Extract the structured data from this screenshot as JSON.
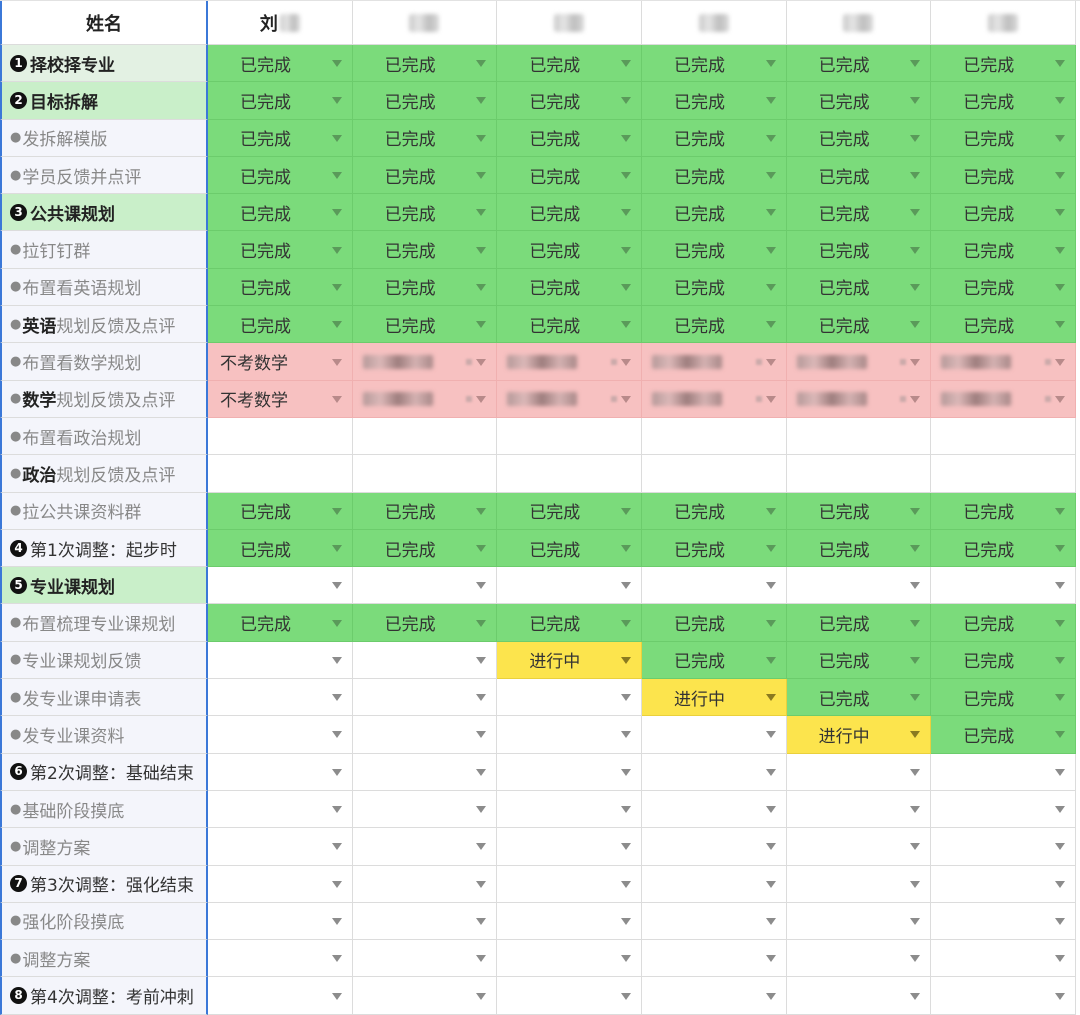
{
  "header": {
    "name_label": "姓名",
    "students": [
      "刘",
      "",
      "",
      "",
      "",
      ""
    ]
  },
  "rows": [
    {
      "label_num": "1",
      "label": "择校择专业",
      "type": "section",
      "cells": [
        "已完成",
        "已完成",
        "已完成",
        "已完成",
        "已完成",
        "已完成"
      ],
      "colors": [
        "green",
        "green",
        "green",
        "green",
        "green",
        "green"
      ]
    },
    {
      "label_num": "2",
      "label": "目标拆解",
      "type": "section-green",
      "cells": [
        "已完成",
        "已完成",
        "已完成",
        "已完成",
        "已完成",
        "已完成"
      ],
      "colors": [
        "green",
        "green",
        "green",
        "green",
        "green",
        "green"
      ]
    },
    {
      "label": "发拆解模版",
      "type": "sub",
      "cells": [
        "已完成",
        "已完成",
        "已完成",
        "已完成",
        "已完成",
        "已完成"
      ],
      "colors": [
        "green",
        "green",
        "green",
        "green",
        "green",
        "green"
      ]
    },
    {
      "label": "学员反馈并点评",
      "type": "sub",
      "cells": [
        "已完成",
        "已完成",
        "已完成",
        "已完成",
        "已完成",
        "已完成"
      ],
      "colors": [
        "green",
        "green",
        "green",
        "green",
        "green",
        "green"
      ]
    },
    {
      "label_num": "3",
      "label": "公共课规划",
      "type": "section-green",
      "cells": [
        "已完成",
        "已完成",
        "已完成",
        "已完成",
        "已完成",
        "已完成"
      ],
      "colors": [
        "green",
        "green",
        "green",
        "green",
        "green",
        "green"
      ]
    },
    {
      "label": "拉钉钉群",
      "type": "sub",
      "cells": [
        "已完成",
        "已完成",
        "已完成",
        "已完成",
        "已完成",
        "已完成"
      ],
      "colors": [
        "green",
        "green",
        "green",
        "green",
        "green",
        "green"
      ]
    },
    {
      "label": "布置看英语规划",
      "type": "sub",
      "cells": [
        "已完成",
        "已完成",
        "已完成",
        "已完成",
        "已完成",
        "已完成"
      ],
      "colors": [
        "green",
        "green",
        "green",
        "green",
        "green",
        "green"
      ]
    },
    {
      "label_bold": "英语",
      "label": "规划反馈及点评",
      "type": "sub",
      "cells": [
        "已完成",
        "已完成",
        "已完成",
        "已完成",
        "已完成",
        "已完成"
      ],
      "colors": [
        "green",
        "green",
        "green",
        "green",
        "green",
        "green"
      ]
    },
    {
      "label": "布置看数学规划",
      "type": "sub",
      "cells": [
        "不考数学",
        "",
        "",
        "",
        "",
        ""
      ],
      "colors": [
        "red",
        "red-blur",
        "red-blur",
        "red-blur",
        "red-blur",
        "red-blur"
      ]
    },
    {
      "label_bold": "数学",
      "label": "规划反馈及点评",
      "type": "sub",
      "cells": [
        "不考数学",
        "",
        "",
        "",
        "",
        ""
      ],
      "colors": [
        "red",
        "red-blur",
        "red-blur",
        "red-blur",
        "red-blur",
        "red-blur"
      ]
    },
    {
      "label": "布置看政治规划",
      "type": "sub",
      "cells": [
        "",
        "",
        "",
        "",
        "",
        ""
      ],
      "colors": [
        "none",
        "none",
        "none",
        "none",
        "none",
        "none"
      ]
    },
    {
      "label_bold": "政治",
      "label": "规划反馈及点评",
      "type": "sub",
      "cells": [
        "",
        "",
        "",
        "",
        "",
        ""
      ],
      "colors": [
        "none",
        "none",
        "none",
        "none",
        "none",
        "none"
      ]
    },
    {
      "label": "拉公共课资料群",
      "type": "sub",
      "cells": [
        "已完成",
        "已完成",
        "已完成",
        "已完成",
        "已完成",
        "已完成"
      ],
      "colors": [
        "green",
        "green",
        "green",
        "green",
        "green",
        "green"
      ]
    },
    {
      "label_num": "4",
      "label": "第1次调整：起步时",
      "type": "section-plain",
      "cells": [
        "已完成",
        "已完成",
        "已完成",
        "已完成",
        "已完成",
        "已完成"
      ],
      "colors": [
        "green",
        "green",
        "green",
        "green",
        "green",
        "green"
      ]
    },
    {
      "label_num": "5",
      "label": "专业课规划",
      "type": "section-green",
      "cells": [
        "",
        "",
        "",
        "",
        "",
        ""
      ],
      "colors": [
        "empty",
        "empty",
        "empty",
        "empty",
        "empty",
        "empty"
      ]
    },
    {
      "label": "布置梳理专业课规划",
      "type": "sub",
      "cells": [
        "已完成",
        "已完成",
        "已完成",
        "已完成",
        "已完成",
        "已完成"
      ],
      "colors": [
        "green",
        "green",
        "green",
        "green",
        "green",
        "green"
      ]
    },
    {
      "label": "专业课规划反馈",
      "type": "sub",
      "cells": [
        "",
        "",
        "进行中",
        "已完成",
        "已完成",
        "已完成"
      ],
      "colors": [
        "empty",
        "empty",
        "yellow",
        "green",
        "green",
        "green"
      ]
    },
    {
      "label": "发专业课申请表",
      "type": "sub",
      "cells": [
        "",
        "",
        "",
        "进行中",
        "已完成",
        "已完成"
      ],
      "colors": [
        "empty",
        "empty",
        "empty",
        "yellow",
        "green",
        "green"
      ]
    },
    {
      "label": "发专业课资料",
      "type": "sub",
      "cells": [
        "",
        "",
        "",
        "",
        "进行中",
        "已完成"
      ],
      "colors": [
        "empty",
        "empty",
        "empty",
        "empty",
        "yellow",
        "green"
      ]
    },
    {
      "label_num": "6",
      "label": "第2次调整：基础结束",
      "type": "section-plain",
      "cells": [
        "",
        "",
        "",
        "",
        "",
        ""
      ],
      "colors": [
        "empty",
        "empty",
        "empty",
        "empty",
        "empty",
        "empty"
      ]
    },
    {
      "label": "基础阶段摸底",
      "type": "sub",
      "cells": [
        "",
        "",
        "",
        "",
        "",
        ""
      ],
      "colors": [
        "empty",
        "empty",
        "empty",
        "empty",
        "empty",
        "empty"
      ]
    },
    {
      "label": "调整方案",
      "type": "sub",
      "cells": [
        "",
        "",
        "",
        "",
        "",
        ""
      ],
      "colors": [
        "empty",
        "empty",
        "empty",
        "empty",
        "empty",
        "empty"
      ]
    },
    {
      "label_num": "7",
      "label": "第3次调整：强化结束",
      "type": "section-plain",
      "cells": [
        "",
        "",
        "",
        "",
        "",
        ""
      ],
      "colors": [
        "empty",
        "empty",
        "empty",
        "empty",
        "empty",
        "empty"
      ]
    },
    {
      "label": "强化阶段摸底",
      "type": "sub",
      "cells": [
        "",
        "",
        "",
        "",
        "",
        ""
      ],
      "colors": [
        "empty",
        "empty",
        "empty",
        "empty",
        "empty",
        "empty"
      ]
    },
    {
      "label": "调整方案",
      "type": "sub",
      "cells": [
        "",
        "",
        "",
        "",
        "",
        ""
      ],
      "colors": [
        "empty",
        "empty",
        "empty",
        "empty",
        "empty",
        "empty"
      ]
    },
    {
      "label_num": "8",
      "label": "第4次调整：考前冲刺",
      "type": "section-plain",
      "cells": [
        "",
        "",
        "",
        "",
        "",
        ""
      ],
      "colors": [
        "empty",
        "empty",
        "empty",
        "empty",
        "empty",
        "empty"
      ]
    }
  ],
  "colors": {
    "done_green": "#7bdb7b",
    "in_progress_yellow": "#fce44d",
    "skip_red": "#f7c1c1",
    "frozen_border_blue": "#3b78d8"
  },
  "icons": {
    "dropdown": "chevron-down-icon",
    "section_number": "circled-number-icon"
  }
}
